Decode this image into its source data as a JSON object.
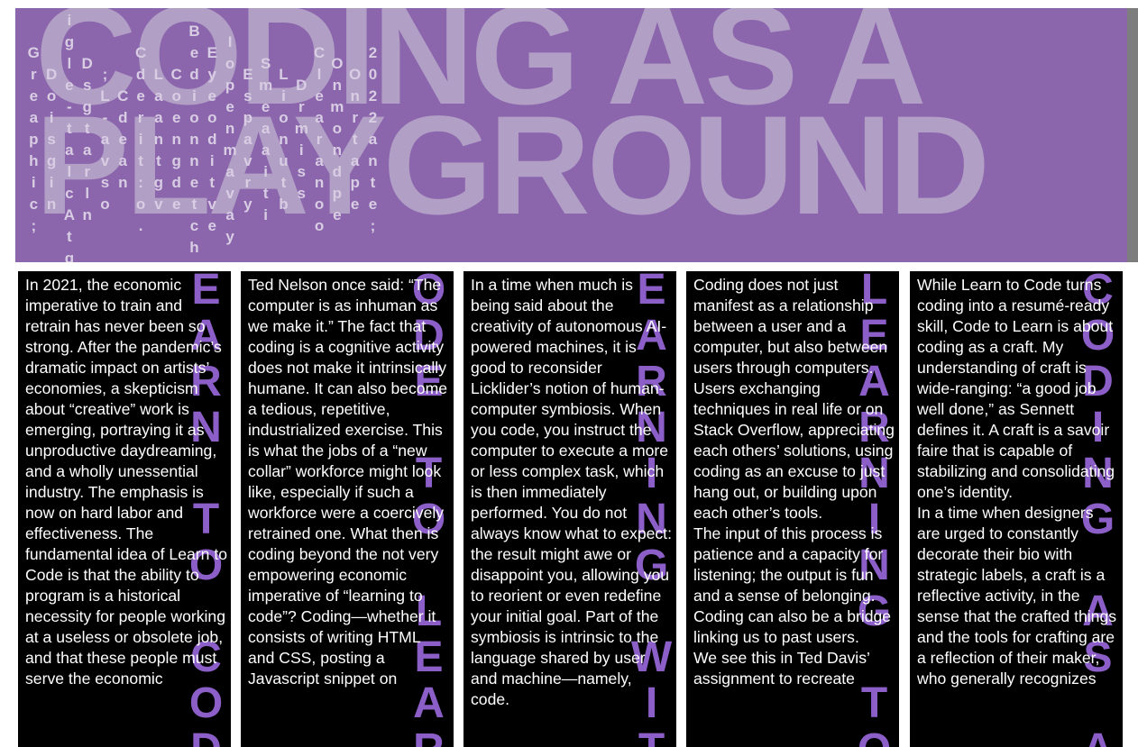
{
  "header": {
    "title": "CODING AS A\nPLAYGROUND",
    "vertical_columns": [
      "Greaphic;",
      "Doisgin",
      "Pigle-talcAtge",
      "Dsgtarln",
      ";L-avso",
      "Cdean",
      "Cderit:o.",
      "Laantgv",
      "Coengde",
      "Bedionnetch",
      "Eyeoditve",
      "Iopenmavay",
      "Espavry",
      "Smeaaiti",
      "Lionutb",
      "Drmiss",
      "Clearanoo",
      "Onmondpe",
      "Onrtape",
      "2022ante;"
    ]
  },
  "columns": [
    {
      "vertical": "LEARN TO CODE",
      "paragraphs": [
        "In 2021, the economic imperative to train and retrain has never been so strong. After the pandemic’s dramatic impact on artists’ economies, a skepticism about “creative” work is emerging, portraying it as unproductive daydreaming, and a wholly unessential industry. The emphasis is now on hard labor and effectiveness. The fundamental idea of Learn to Code is that the ability to program is a historical necessity for people working at a useless or obsolete job, and that these people must serve the economic"
      ]
    },
    {
      "vertical": "CODE TO LEARN",
      "paragraphs": [
        "Ted Nelson once said: “The computer is as inhuman as we make it.” The fact that coding is a cognitive activity does not make it intrinsically humane. It can also become a tedious, repetitive, industrialized exercise. This is what the jobs of a “new collar” workforce might look like, especially if such a workforce were a coercively retrained one. What then is coding beyond the not very empowering economic imperative of “learning to code”? Coding—whether it consists of writing HTML and CSS, posting a Javascript snippet on"
      ]
    },
    {
      "vertical": "LEARNING WITH",
      "paragraphs": [
        "In a time when much is being said about the creativity of autonomous AI-powered machines, it is good to reconsider Licklider’s notion of human-computer symbiosis. When you code, you instruct the computer to execute a more or less complex task, which is then immediately performed. You do not always know what to expect: the result might awe or disappoint you, allowing you to reorient or even redefine your initial goal. Part of the symbiosis is intrinsic to the language shared by user and machine—namely, code."
      ]
    },
    {
      "vertical": "LEARNING TO",
      "paragraphs": [
        "Coding does not just manifest as a relationship between a user and a computer, but also between users through computers. Users exchanging techniques in real life or on Stack Overflow, appreciating each others’ solutions, using coding as an excuse to just hang out, or building upon each other’s tools.",
        "The input of this process is patience and a capacity for listening; the output is fun and a sense of belonging. Coding can also be a bridge linking us to past users.",
        "We see this in Ted Davis’ assignment to recreate"
      ]
    },
    {
      "vertical": "CODING AS A",
      "paragraphs": [
        "While Learn to Code turns coding into a resumé-ready skill, Code to Learn is about coding as a craft. My understanding of craft is wide-ranging: “a good job well done,” as Sennett defines it. A craft is a savoir faire that is capable of stabilizing and consolidating one’s identity.",
        "In a time when designers are urged to constantly decorate their bio with strategic labels, a craft is a reflective activity, in the sense that the crafted things and the tools for crafting are a reflection of their maker, who generally recognizes"
      ]
    }
  ]
}
